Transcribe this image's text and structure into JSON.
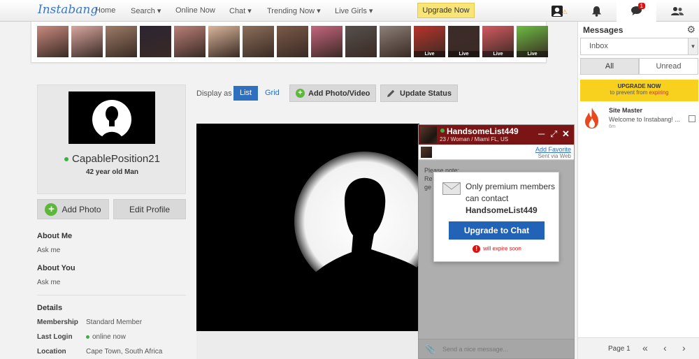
{
  "nav": {
    "logo": "Instabang",
    "items": [
      "Home",
      "Search ▾",
      "Online Now",
      "Chat ▾",
      "Trending Now ▾",
      "Live Girls ▾"
    ],
    "upgrade": "Upgrade Now",
    "notification_count": "1",
    "icons": [
      "profile-alert-icon",
      "bell-icon",
      "chat-bubble-icon",
      "users-icon"
    ]
  },
  "strip": {
    "thumbs": [
      {
        "color": "#c98a7e",
        "live": ""
      },
      {
        "color": "#d8a7a0",
        "live": ""
      },
      {
        "color": "#9c7b66",
        "live": ""
      },
      {
        "color": "#2b2433",
        "live": ""
      },
      {
        "color": "#b97f77",
        "live": ""
      },
      {
        "color": "#d9b69b",
        "live": ""
      },
      {
        "color": "#8b6f5a",
        "live": ""
      },
      {
        "color": "#7a5a48",
        "live": ""
      },
      {
        "color": "#c6657f",
        "live": ""
      },
      {
        "color": "#55504d",
        "live": ""
      },
      {
        "color": "#8c8078",
        "live": ""
      },
      {
        "color": "#b8342b",
        "live": "Live"
      },
      {
        "color": "#3d2c2a",
        "live": "Live"
      },
      {
        "color": "#d35a60",
        "live": "Live"
      },
      {
        "color": "#6cbd42",
        "live": "Live"
      }
    ]
  },
  "profile": {
    "username": "CapablePosition21",
    "age_gender": "42 year old Man",
    "add_photo": "Add Photo",
    "edit_profile": "Edit Profile",
    "about_me_h": "About Me",
    "about_me_t": "Ask me",
    "about_you_h": "About You",
    "about_you_t": "Ask me",
    "details_h": "Details",
    "details": [
      {
        "label": "Membership",
        "value": "Standard Member"
      },
      {
        "label": "Last Login",
        "value": "online now"
      },
      {
        "label": "Location",
        "value": "Cape Town, South Africa"
      }
    ]
  },
  "main": {
    "display_as": "Display as",
    "list": "List",
    "grid": "Grid",
    "add_photo_video": "Add Photo/Video",
    "update_status": "Update Status"
  },
  "chat": {
    "name": "HandsomeList449",
    "sub": "23 / Woman / Miami FL, US",
    "add_favorite": "Add Favorite",
    "sent_via": "Sent via Web",
    "note": "Please note:",
    "note_a": "Re",
    "note_b": "ge",
    "placeholder": "Send a nice message...",
    "popup": {
      "line1": "Only premium members can contact",
      "target": "HandsomeList449",
      "button": "Upgrade to Chat",
      "expire": "will expire soon"
    }
  },
  "messages": {
    "title": "Messages",
    "folder": "Inbox",
    "tab_all": "All",
    "tab_unread": "Unread",
    "upgrade_l1": "UPGRADE NOW",
    "upgrade_l2": "to prevent from",
    "upgrade_l2b": "expiring",
    "item": {
      "from": "Site Master",
      "preview": "Welcome to Instabang! ...",
      "time": "6m"
    },
    "page": "Page 1"
  }
}
